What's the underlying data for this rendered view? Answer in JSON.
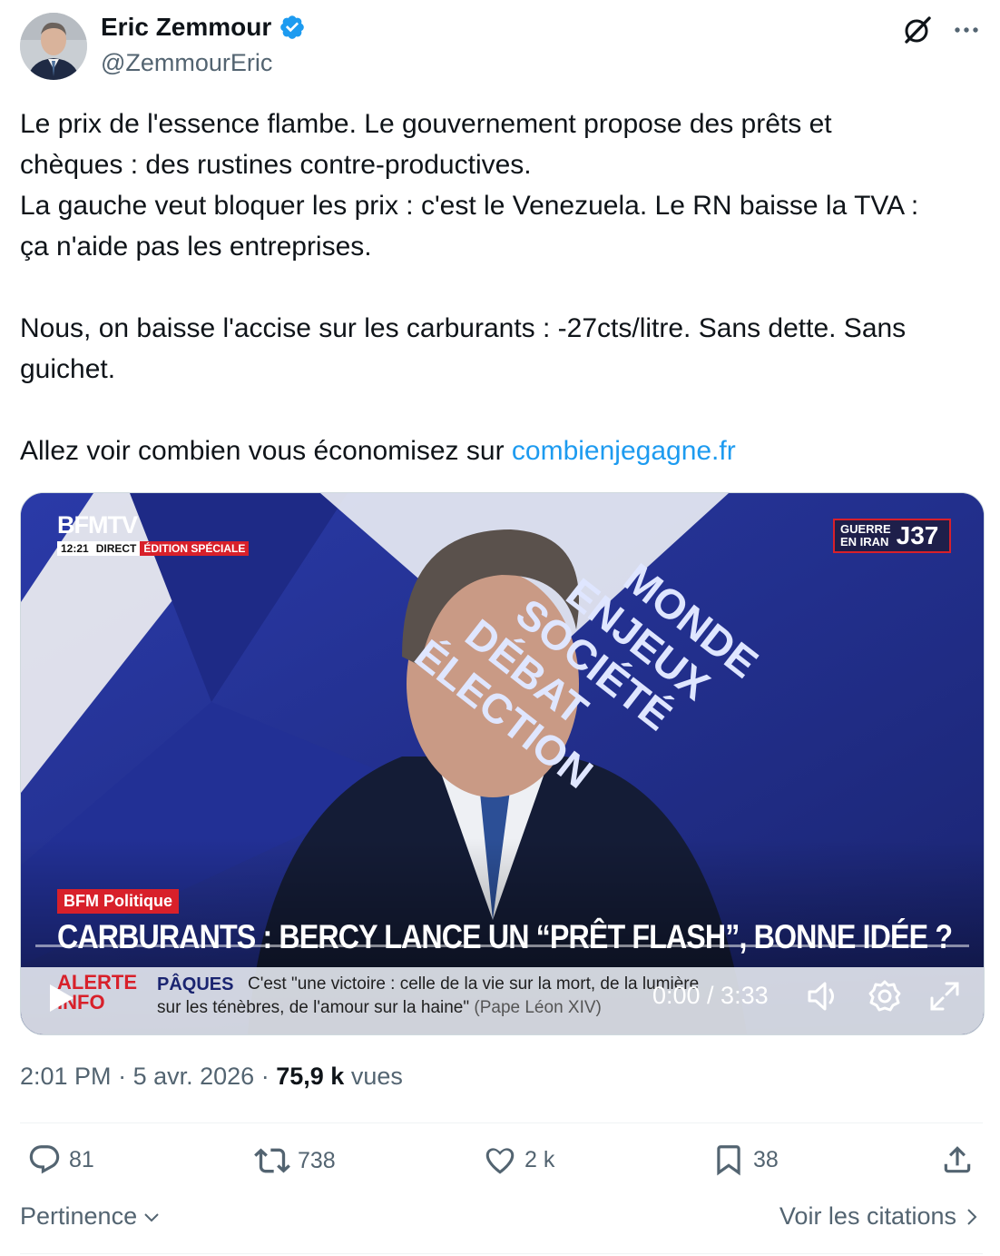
{
  "author": {
    "name": "Eric Zemmour",
    "handle": "@ZemmourEric",
    "verified": true,
    "verified_color": "#1d9bf0"
  },
  "tweet": {
    "lines": [
      "Le prix de l'essence flambe. Le gouvernement propose des prêts et",
      "chèques : des rustines contre-productives.",
      "La gauche veut bloquer les prix : c'est le Venezuela. Le RN baisse la TVA :",
      "ça n'aide pas les entreprises.",
      "Nous, on baisse l'accise sur les carburants : -27cts/litre. Sans dette. Sans",
      "guichet."
    ],
    "last_line_prefix": "Allez voir combien vous économisez sur ",
    "link_text": "combienjegagne.fr",
    "link_color": "#1d9bf0"
  },
  "video": {
    "channel_logo": "BFMTV",
    "time": "12:21",
    "direct": "DIRECT",
    "edition": "ÉDITION SPÉCIALE",
    "badge_top": "GUERRE",
    "badge_bottom": "EN IRAN",
    "badge_day": "J37",
    "backdrop_words": [
      "MONDE",
      "ENJEUX",
      "SOCIÉTÉ",
      "DÉBAT",
      "ÉLECTION"
    ],
    "program_tag": "BFM Politique",
    "headline": "CARBURANTS : BERCY LANCE UN “PRÊT FLASH”, BONNE IDÉE ?",
    "ticker_label_1": "ALERTE",
    "ticker_label_2": "INFO",
    "ticker_topic": "PÂQUES",
    "ticker_line_1": "C'est \"une victoire : celle de la vie sur la mort, de la lumière",
    "ticker_line_2": "sur les ténèbres, de l'amour sur la haine\"",
    "ticker_attrib": "(Pape Léon XIV)",
    "player_time": "0:00 / 3:33",
    "progress": 0
  },
  "meta": {
    "time": "2:01 PM",
    "sep": "·",
    "date": "5 avr. 2026",
    "views": "75,9 k",
    "views_label": "vues"
  },
  "actions": {
    "replies": "81",
    "reposts": "738",
    "likes": "2 k",
    "bookmarks": "38"
  },
  "footer": {
    "sort_label": "Pertinence",
    "quotes_label": "Voir les citations"
  },
  "icons": [
    "verified-badge-icon",
    "grok-icon",
    "more-icon",
    "play-icon",
    "volume-icon",
    "settings-icon",
    "fullscreen-icon",
    "reply-icon",
    "repost-icon",
    "like-icon",
    "bookmark-icon",
    "share-icon",
    "chevron-down-icon",
    "chevron-right-icon"
  ]
}
